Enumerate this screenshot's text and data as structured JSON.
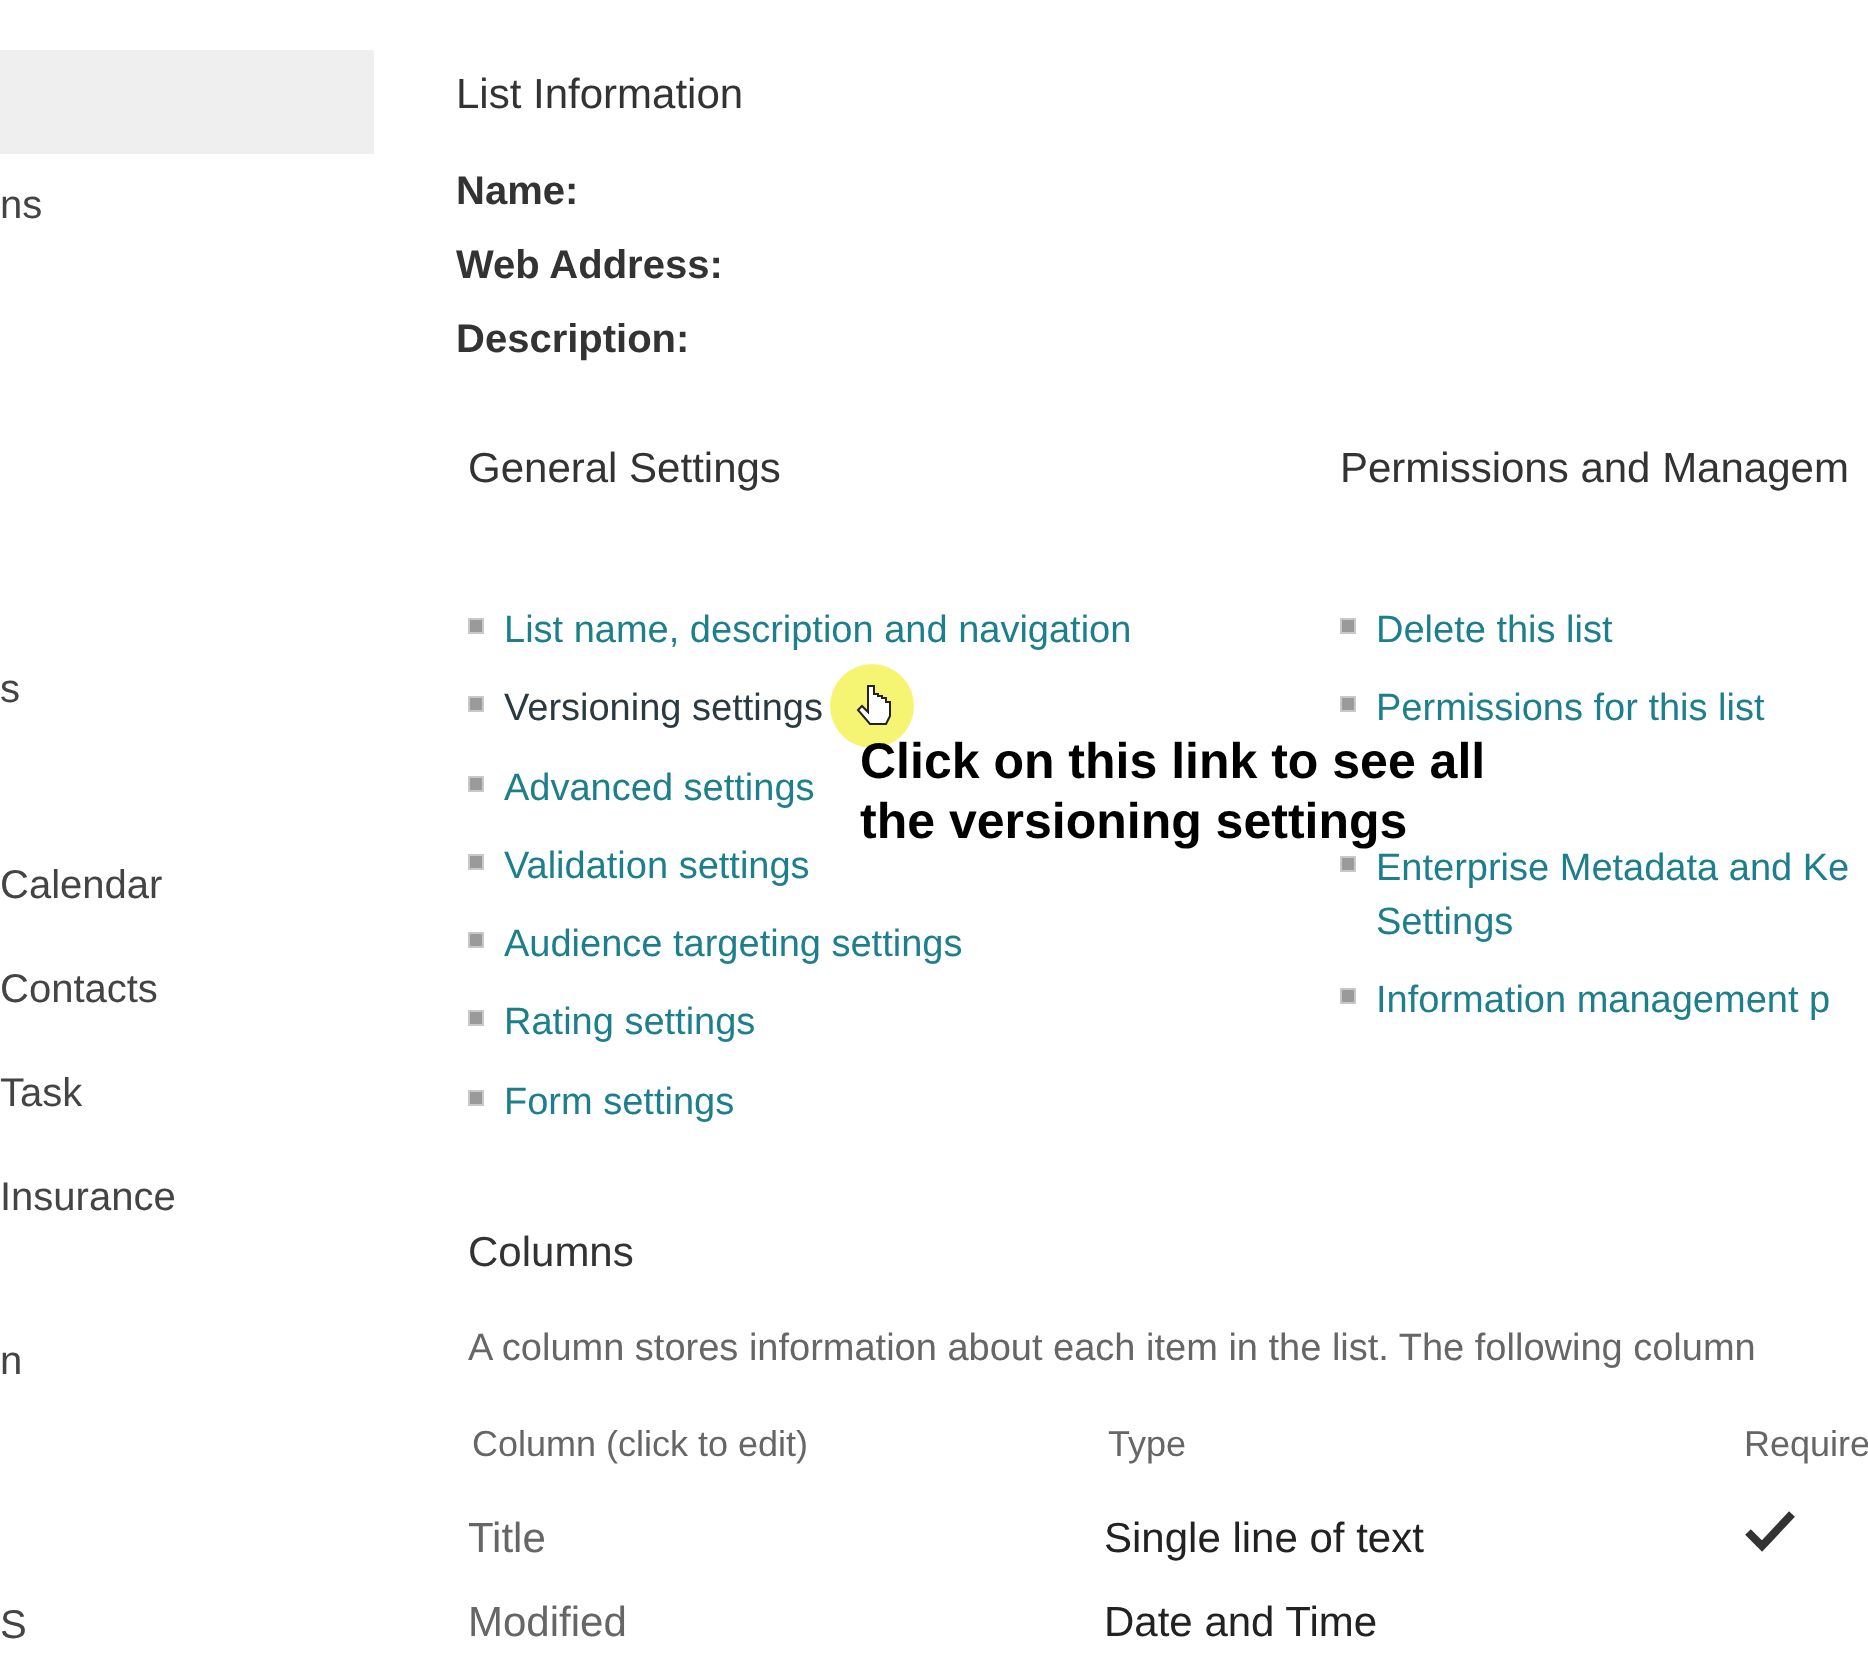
{
  "sidebar": {
    "items": [
      {
        "selected": true
      },
      {
        "label": "ns",
        "selected": false
      },
      {
        "label": "s",
        "selected": false
      },
      {
        "label": "Calendar",
        "selected": false
      },
      {
        "label": "Contacts",
        "selected": false
      },
      {
        "label": "Task",
        "selected": false
      },
      {
        "label": "Insurance",
        "selected": false
      },
      {
        "label": "n",
        "selected": false
      },
      {
        "label": "S",
        "selected": false
      }
    ]
  },
  "list_information": {
    "title": "List Information",
    "fields": [
      "Name:",
      "Web Address:",
      "Description:"
    ]
  },
  "general_settings": {
    "title": "General Settings",
    "links": [
      {
        "label": "List name, description and navigation",
        "hovered": false
      },
      {
        "label": "Versioning settings",
        "hovered": true
      },
      {
        "label": "Advanced settings",
        "hovered": false
      },
      {
        "label": "Validation settings",
        "hovered": false
      },
      {
        "label": "Audience targeting settings",
        "hovered": false
      },
      {
        "label": "Rating settings",
        "hovered": false
      },
      {
        "label": "Form settings",
        "hovered": false
      }
    ]
  },
  "permissions_and_management": {
    "title": "Permissions and Managem",
    "links": [
      {
        "label": "Delete this list"
      },
      {
        "label": "Permissions for this list"
      },
      {
        "label": "Enterprise Metadata and Ke Settings"
      },
      {
        "label": "Information management p"
      }
    ]
  },
  "callout": "Click on this link to see all the versioning settings",
  "columns": {
    "title": "Columns",
    "description": "A column stores information about each item in the list. The following column",
    "headers": [
      "Column (click to edit)",
      "Type",
      "Require"
    ],
    "rows": [
      {
        "name": "Title",
        "type": "Single line of text",
        "required": true
      },
      {
        "name": "Modified",
        "type": "Date and Time",
        "required": false
      }
    ]
  }
}
